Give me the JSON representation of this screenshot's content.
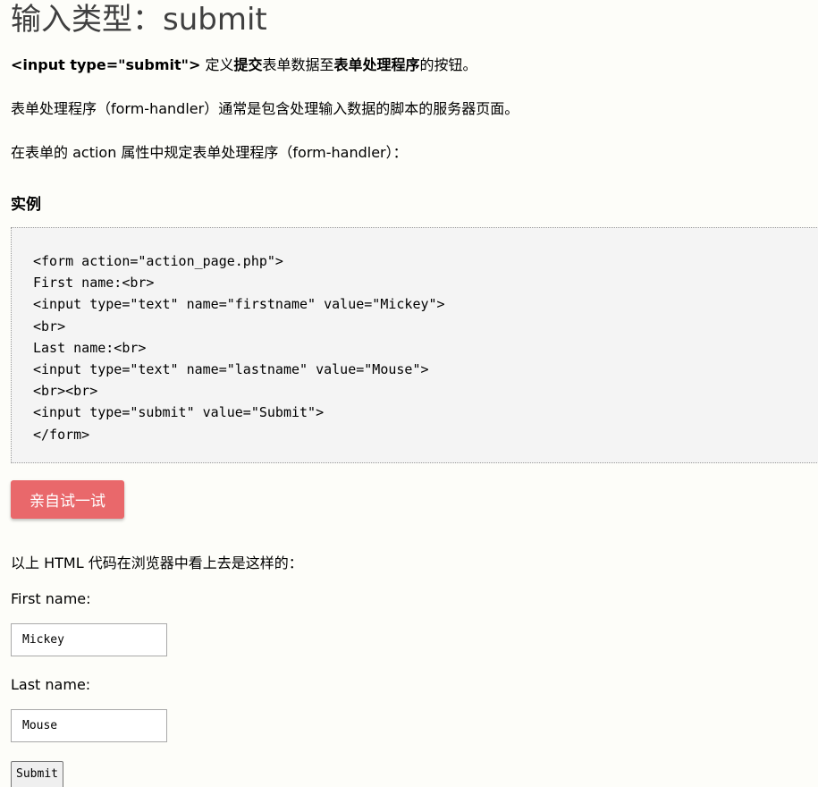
{
  "title": "输入类型：submit",
  "intro": {
    "code_tag": "<input type=\"submit\">",
    "text_1": " 定义",
    "bold_1": "提交",
    "text_2": "表单数据至",
    "bold_2": "表单处理程序",
    "text_3": "的按钮。"
  },
  "para_2": "表单处理程序（form-handler）通常是包含处理输入数据的脚本的服务器页面。",
  "para_3": "在表单的 action 属性中规定表单处理程序（form-handler）：",
  "example": {
    "heading": "实例",
    "code": "<form action=\"action_page.php\">\nFirst name:<br>\n<input type=\"text\" name=\"firstname\" value=\"Mickey\">\n<br>\nLast name:<br>\n<input type=\"text\" name=\"lastname\" value=\"Mouse\">\n<br><br>\n<input type=\"submit\" value=\"Submit\">\n</form>"
  },
  "try_button": "亲自试一试",
  "result_intro": "以上 HTML 代码在浏览器中看上去是这样的：",
  "demo_form": {
    "first_label": "First name:",
    "first_value": "Mickey",
    "last_label": "Last name:",
    "last_value": "Mouse",
    "submit_label": "Submit"
  },
  "colors": {
    "try_button_bg": "#e9686b",
    "example_bg": "#f4f4f4",
    "page_bg": "#fdfdf9"
  }
}
